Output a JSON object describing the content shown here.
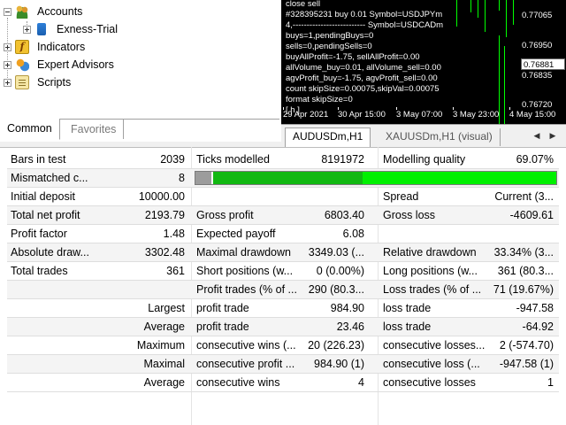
{
  "navigator": {
    "items": [
      {
        "label": "Accounts",
        "icon": "accounts-icon"
      },
      {
        "label": "Exness-Trial",
        "icon": "server-icon"
      },
      {
        "label": "Indicators",
        "icon": "indicators-icon"
      },
      {
        "label": "Expert Advisors",
        "icon": "expert-advisors-icon"
      },
      {
        "label": "Scripts",
        "icon": "scripts-icon"
      }
    ],
    "tabs": [
      {
        "label": "Common",
        "active": true
      },
      {
        "label": "Favorites",
        "active": false
      }
    ]
  },
  "chart": {
    "comment_lines": [
      "close sell",
      "#328395231 buy 0.01 Symbol=USDJPYm",
      "4,-------------------------- Symbol=USDCADm",
      "buys=1,pendingBuys=0",
      "sells=0,pendingSells=0",
      "buyAllProfit=-1.75, sellAllProfit=0.00",
      "allVolume_buy=0.01, allVolume_sell=0.00",
      "agvProfit_buy=-1.75, agvProfit_sell=0.00",
      "count skipSize=0.00075,skipVal=0.00075",
      "format skipSize=0",
      "[ h ]"
    ],
    "price_labels": [
      "0.7706",
      "0.7695",
      "0.7684",
      "0.7672"
    ],
    "price_labels_full": [
      "0.77065",
      "0.76950",
      "0.76835",
      "0.76720"
    ],
    "current_price": "0.76881",
    "time_labels": [
      "29 Apr 2021",
      "30 Apr 15:00",
      "3 May 07:00",
      "3 May 23:00",
      "4 May 15:00"
    ],
    "tabs": [
      {
        "label": "AUDUSDm,H1",
        "active": true
      },
      {
        "label": "XAUUSDm,H1 (visual)",
        "active": false
      }
    ],
    "colors": {
      "background": "#000000",
      "bull": "#00ff00",
      "text": "#ffffff"
    }
  },
  "report": {
    "modelling_quality_percent": 69.07,
    "rows": [
      {
        "c1": "Bars in test",
        "v1": "2039",
        "c2": "Ticks modelled",
        "v2": "8191972",
        "c3": "Modelling quality",
        "v3": "69.07%"
      },
      {
        "c1": "Mismatched c...",
        "v1": "8",
        "bar": true
      },
      {
        "c1": "Initial deposit",
        "v1": "10000.00",
        "c2": "",
        "v2": "",
        "c3": "Spread",
        "v3": "Current (3..."
      },
      {
        "c1": "Total net profit",
        "v1": "2193.79",
        "c2": "Gross profit",
        "v2": "6803.40",
        "c3": "Gross loss",
        "v3": "-4609.61"
      },
      {
        "c1": "Profit factor",
        "v1": "1.48",
        "c2": "Expected payoff",
        "v2": "6.08",
        "c3": "",
        "v3": ""
      },
      {
        "c1": "Absolute draw...",
        "v1": "3302.48",
        "c2": "Maximal drawdown",
        "v2": "3349.03 (...",
        "c3": "Relative drawdown",
        "v3": "33.34% (3..."
      },
      {
        "c1": "Total trades",
        "v1": "361",
        "c2": "Short positions (w...",
        "v2": "0 (0.00%)",
        "c3": "Long positions (w...",
        "v3": "361 (80.3..."
      },
      {
        "c1": "",
        "v1": "",
        "c2": "Profit trades (% of ...",
        "v2": "290 (80.3...",
        "c3": "Loss trades (% of ...",
        "v3": "71 (19.67%)"
      },
      {
        "c1": "",
        "v1": "Largest",
        "c2": "profit trade",
        "v2": "984.90",
        "c3": "loss trade",
        "v3": "-947.58"
      },
      {
        "c1": "",
        "v1": "Average",
        "c2": "profit trade",
        "v2": "23.46",
        "c3": "loss trade",
        "v3": "-64.92"
      },
      {
        "c1": "",
        "v1": "Maximum",
        "c2": "consecutive wins (...",
        "v2": "20 (226.23)",
        "c3": "consecutive losses...",
        "v3": "2 (-574.70)"
      },
      {
        "c1": "",
        "v1": "Maximal",
        "c2": "consecutive profit ...",
        "v2": "984.90 (1)",
        "c3": "consecutive loss (...",
        "v3": "-947.58 (1)"
      },
      {
        "c1": "",
        "v1": "Average",
        "c2": "consecutive wins",
        "v2": "4",
        "c3": "consecutive losses",
        "v3": "1"
      }
    ]
  }
}
